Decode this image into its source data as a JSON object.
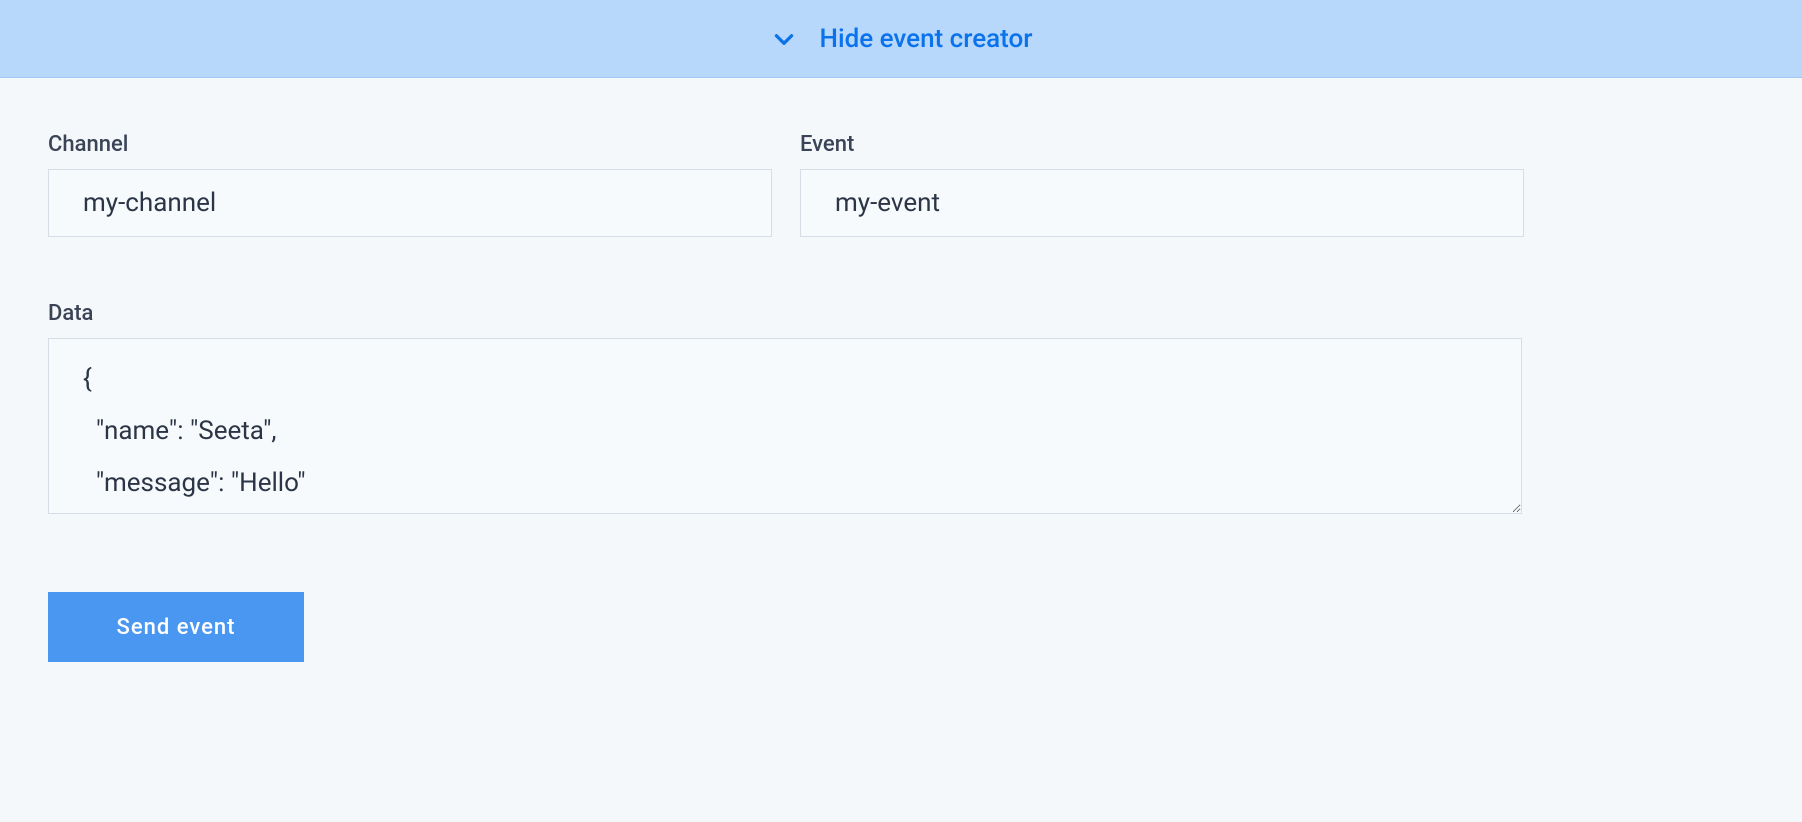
{
  "toggle": {
    "label": "Hide event creator"
  },
  "form": {
    "channel": {
      "label": "Channel",
      "value": "my-channel"
    },
    "event": {
      "label": "Event",
      "value": "my-event"
    },
    "data": {
      "label": "Data",
      "value": "{\n  \"name\": \"Seeta\",\n  \"message\": \"Hello\""
    },
    "submit_label": "Send event"
  }
}
